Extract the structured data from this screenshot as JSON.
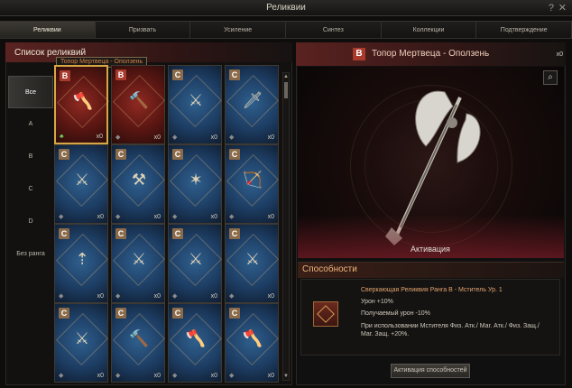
{
  "window": {
    "title": "Реликвии",
    "help_label": "?",
    "close_label": "✕"
  },
  "tabs": [
    {
      "label": "Реликвии"
    },
    {
      "label": "Призвать"
    },
    {
      "label": "Усиление"
    },
    {
      "label": "Синтез"
    },
    {
      "label": "Коллекции"
    },
    {
      "label": "Подтверждение"
    }
  ],
  "left": {
    "title": "Список реликвий",
    "tooltip": "Топор Мертвеца - Оползень",
    "filters": [
      {
        "label": "Все"
      },
      {
        "label": "A"
      },
      {
        "label": "B"
      },
      {
        "label": "C"
      },
      {
        "label": "D"
      },
      {
        "label": "Без ранга"
      }
    ],
    "cards": [
      {
        "grade": "B",
        "color": "red",
        "icon": "axe-icon",
        "count": "x0",
        "selected": true,
        "gem_icon": "clover-icon"
      },
      {
        "grade": "B",
        "color": "red",
        "icon": "hammer-icon",
        "count": "x0",
        "selected": false,
        "gem_icon": "gem-icon"
      },
      {
        "grade": "C",
        "color": "blue",
        "icon": "crossbow-icon",
        "count": "x0",
        "selected": false,
        "gem_icon": "gem-icon"
      },
      {
        "grade": "C",
        "color": "blue",
        "icon": "dagger-icon",
        "count": "x0",
        "selected": false,
        "gem_icon": "gem-icon"
      },
      {
        "grade": "C",
        "color": "blue",
        "icon": "sword-icon",
        "count": "x0",
        "selected": false,
        "gem_icon": "gem-icon"
      },
      {
        "grade": "C",
        "color": "blue",
        "icon": "mace-icon",
        "count": "x0",
        "selected": false,
        "gem_icon": "gem-icon"
      },
      {
        "grade": "C",
        "color": "blue",
        "icon": "scepter-icon",
        "count": "x0",
        "selected": false,
        "gem_icon": "gem-icon"
      },
      {
        "grade": "C",
        "color": "blue",
        "icon": "bow-icon",
        "count": "x0",
        "selected": false,
        "gem_icon": "gem-icon"
      },
      {
        "grade": "C",
        "color": "blue",
        "icon": "spear-icon",
        "count": "x0",
        "selected": false,
        "gem_icon": "gem-icon"
      },
      {
        "grade": "C",
        "color": "blue",
        "icon": "crossed-swords-icon",
        "count": "x0",
        "selected": false,
        "gem_icon": "gem-icon"
      },
      {
        "grade": "C",
        "color": "blue",
        "icon": "crossed-swords-icon",
        "count": "x0",
        "selected": false,
        "gem_icon": "gem-icon"
      },
      {
        "grade": "C",
        "color": "blue",
        "icon": "crossed-swords-icon",
        "count": "x0",
        "selected": false,
        "gem_icon": "gem-icon"
      },
      {
        "grade": "C",
        "color": "blue",
        "icon": "crossed-swords-icon",
        "count": "x0",
        "selected": false,
        "gem_icon": "gem-icon"
      },
      {
        "grade": "C",
        "color": "blue",
        "icon": "hammer-icon",
        "count": "x0",
        "selected": false,
        "gem_icon": "gem-icon"
      },
      {
        "grade": "C",
        "color": "blue",
        "icon": "axe-icon",
        "count": "x0",
        "selected": false,
        "gem_icon": "gem-icon"
      },
      {
        "grade": "C",
        "color": "blue",
        "icon": "axe-icon",
        "count": "x0",
        "selected": false,
        "gem_icon": "gem-icon"
      }
    ]
  },
  "detail": {
    "grade": "B",
    "title": "Топор Мертвеца - Оползень",
    "count": "x0",
    "preview_label": "Активация",
    "abilities_title": "Способности",
    "ability": {
      "title": "Сверкающая Реликвия Ранга B - Мститель Ур. 1",
      "line1": "Урон +10%",
      "line2": "Получаемый урон -10%",
      "desc": "При использовании Мстителя Физ. Атк./ Маг. Атк./ Физ. Защ./ Маг. Защ. +20%."
    },
    "activate_button": "Активация способностей"
  }
}
